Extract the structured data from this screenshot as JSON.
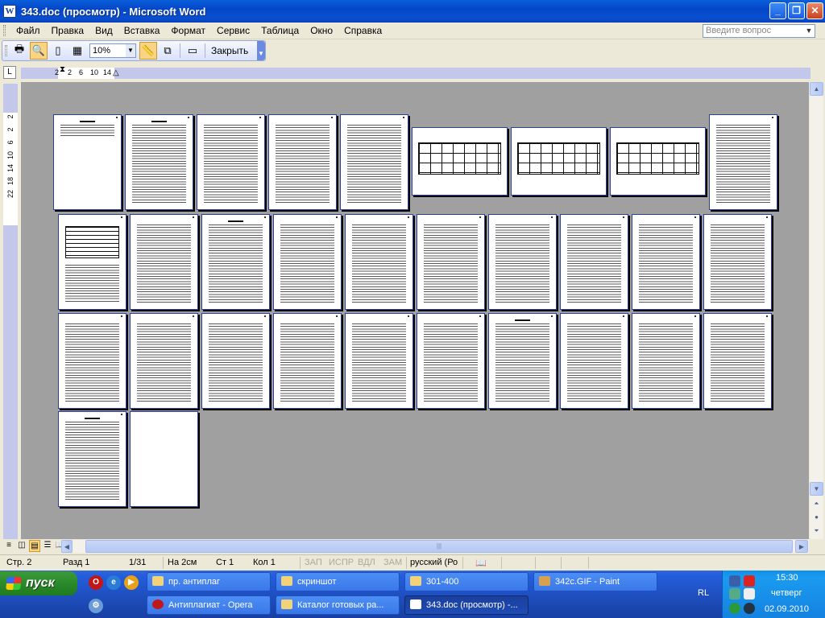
{
  "window": {
    "title": "343.doc (просмотр) - Microsoft Word",
    "icon": "word-doc-icon",
    "controls": [
      "minimize",
      "maximize",
      "close"
    ]
  },
  "menu": {
    "items": [
      "Файл",
      "Правка",
      "Вид",
      "Вставка",
      "Формат",
      "Сервис",
      "Таблица",
      "Окно",
      "Справка"
    ],
    "help_placeholder": "Введите вопрос"
  },
  "toolbar": {
    "zoom_value": "10%",
    "close_label": "Закрыть"
  },
  "ruler": {
    "h_numbers": [
      "2",
      "2",
      "6",
      "10",
      "14"
    ],
    "v_numbers": [
      "2",
      "2",
      "6",
      "10",
      "14",
      "18",
      "22"
    ]
  },
  "preview": {
    "rows": [
      [
        "page",
        "page",
        "page",
        "page",
        "page",
        "landscape",
        "landscape",
        "landscape",
        "page"
      ],
      [
        "table",
        "page",
        "page",
        "page",
        "page",
        "page",
        "page",
        "page",
        "page",
        "page"
      ],
      [
        "page",
        "page",
        "page",
        "page",
        "page",
        "page",
        "page",
        "page",
        "page",
        "page"
      ],
      [
        "page",
        "blank"
      ]
    ]
  },
  "status": {
    "page": "Стр. 2",
    "section": "Разд 1",
    "pages": "1/31",
    "at": "На 2см",
    "line": "Ст 1",
    "col": "Кол 1",
    "rec": "ЗАП",
    "trk": "ИСПР",
    "ext": "ВДЛ",
    "ovr": "ЗАМ",
    "language": "русский (Ро"
  },
  "taskbar": {
    "start_label": "пуск",
    "row1": [
      {
        "label": "пр. антиплаг",
        "icon": "folder-icon"
      },
      {
        "label": "скриншот",
        "icon": "folder-icon"
      },
      {
        "label": "301-400",
        "icon": "folder-icon"
      },
      {
        "label": "342c.GIF - Paint",
        "icon": "paint-icon"
      }
    ],
    "row2": [
      {
        "label": "Антиплагиат - Opera",
        "icon": "opera-icon"
      },
      {
        "label": "Каталог готовых ра...",
        "icon": "folder-icon"
      },
      {
        "label": "343.doc (просмотр) -...",
        "icon": "word-icon",
        "active": true
      }
    ],
    "lang": "RL",
    "clock_time": "15:30",
    "clock_day": "четверг",
    "clock_date": "02.09.2010"
  }
}
